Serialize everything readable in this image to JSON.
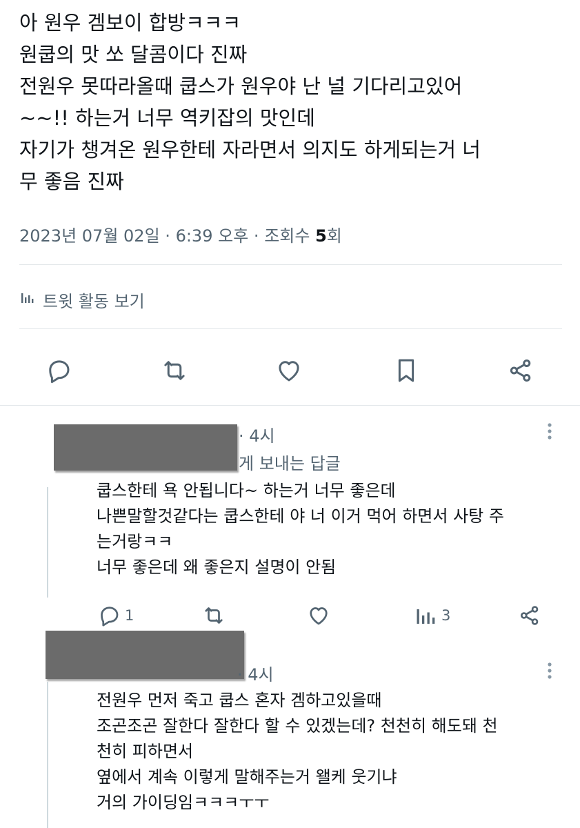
{
  "tweet": {
    "lines": [
      "아 원우 겜보이 합방ㅋㅋㅋ",
      "원쿱의 맛 쏘 달콤이다 진짜",
      "전원우 못따라올때 쿱스가 원우야 난 널 기다리고있어",
      "~~!! 하는거 너무 역키잡의 맛인데",
      "자기가 챙겨온 원우한테 자라면서 의지도 하게되는거 너",
      "무 좋음 진짜"
    ],
    "date": "2023년 07월 02일",
    "separator": "·",
    "time": "6:39 오후",
    "views_label": "조회수",
    "views_count": "5",
    "views_unit": "회",
    "activity_label": "트윗 활동 보기",
    "activity_icon": "analytics-icon"
  },
  "actions": {
    "icons": [
      "reply-icon",
      "retweet-icon",
      "like-icon",
      "bookmark-icon",
      "share-icon"
    ]
  },
  "replies": [
    {
      "time": "· 4시",
      "context": "게 보내는 답글",
      "lines": [
        "쿱스한테 욕 안됩니다~ 하는거 너무 좋은데",
        "나쁜말할것같다는 쿱스한테 야 너 이거 먹어 하면서 사탕 주",
        "는거랑ㅋㅋ",
        "너무 좋은데 왜 좋은지 설명이 안됨"
      ],
      "reply_count": "1",
      "views_count": "3"
    },
    {
      "time": "· 4시",
      "lines": [
        "전원우 먼저 죽고 쿱스 혼자 겜하고있을때",
        "조곤조곤 잘한다 잘한다 할 수 있겠는데? 천천히 해도돼 천",
        "천히 피하면서",
        "옆에서 계속 이렇게 말해주는거 왤케 웃기냐",
        "거의 가이딩임ㅋㅋㅋㅜㅜ"
      ]
    }
  ],
  "colors": {
    "text": "#0f1419",
    "secondary": "#536471",
    "divider": "#e3e7ea",
    "redaction": "#6b6b6b"
  }
}
